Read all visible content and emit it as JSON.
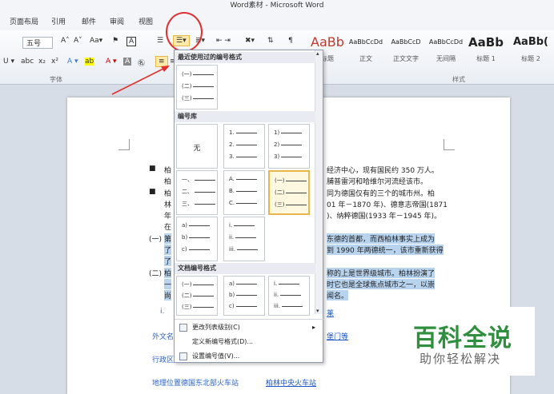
{
  "window": {
    "title": "Word素材 - Microsoft Word"
  },
  "ribbon_tabs": [
    "页面布局",
    "引用",
    "邮件",
    "审阅",
    "视图"
  ],
  "font": {
    "size": "五号",
    "group_label": "字体"
  },
  "styles": {
    "group_label": "样式",
    "items": [
      {
        "sample": "AaBb",
        "name": "标题"
      },
      {
        "sample": "AaBbCcDd",
        "name": "正文"
      },
      {
        "sample": "AaBbCcD",
        "name": "正文文字"
      },
      {
        "sample": "AaBbCcDd",
        "name": "无间隔"
      },
      {
        "sample": "AaBb",
        "name": "标题 1"
      },
      {
        "sample": "AaBb(",
        "name": "标题 2"
      }
    ]
  },
  "numbering_menu": {
    "recent_header": "最近使用过的编号格式",
    "library_header": "编号库",
    "doc_header": "文档编号格式",
    "recent": [
      [
        "(一)",
        "(二)",
        "(三)"
      ]
    ],
    "library": [
      {
        "none": "无"
      },
      [
        "1.",
        "2.",
        "3."
      ],
      [
        "1)",
        "2)",
        "3)"
      ],
      [
        "一、",
        "二、",
        "三、"
      ],
      [
        "A.",
        "B.",
        "C."
      ],
      [
        "(一)",
        "(二)",
        "(三)"
      ],
      [
        "a)",
        "b)",
        "c)"
      ],
      [
        "i.",
        "ii.",
        "iii."
      ]
    ],
    "document": [
      [
        "(一)",
        "(二)",
        "(三)"
      ],
      [
        "a)",
        "b)",
        "c)"
      ],
      [
        "i.",
        "ii.",
        "iii."
      ]
    ],
    "commands": [
      "更改列表级别(C)",
      "定义新编号格式(D)...",
      "设置编号值(V)..."
    ]
  },
  "document": {
    "lines": [
      {
        "bullet": "■",
        "text": "柏",
        "right": "经济中心，现有国民约 350 万人。"
      },
      {
        "text": "柏",
        "right": "脯普雷河和哈维尔河流经该市。"
      },
      {
        "bullet": "■",
        "text": "柏",
        "right": "同为德国仅有的三个的城市州。柏"
      },
      {
        "text": "林",
        "right": "01 年－1870 年)、德意志帝国(1871"
      },
      {
        "text": "年",
        "right": ")、纳粹德国(1933 年－1945 年)。"
      },
      {
        "text": "在",
        "right": ""
      },
      {
        "num": "(一)",
        "text": "第",
        "right": "东德的首都，而西柏林事实上成为"
      },
      {
        "text": "了",
        "right": "到 1990 年两德统一，该市重新获得"
      },
      {
        "text": "了",
        "right": ""
      },
      {
        "num": "(二)",
        "text": "柏",
        "right": "称的上是世界级城市。柏林扮演了"
      },
      {
        "text": "一",
        "right": "时它也是全球焦点城市之一，以崇"
      },
      {
        "text": "尚",
        "right": "闻名。"
      },
      {
        "text": "i.",
        "right": "莱"
      },
      {
        "text": "外文名",
        "right": "堡门等"
      },
      {
        "text": "行政区",
        "right": ""
      },
      {
        "text": "地理位置德国东北部火车站",
        "link": "柏林中央火车站"
      }
    ]
  },
  "watermark": {
    "title": "百科全说",
    "subtitle": "助你轻松解决"
  },
  "colors": {
    "accent_red": "#e03030",
    "selection": "#b7d3ee",
    "watermark_green": "#2f8f3e"
  }
}
